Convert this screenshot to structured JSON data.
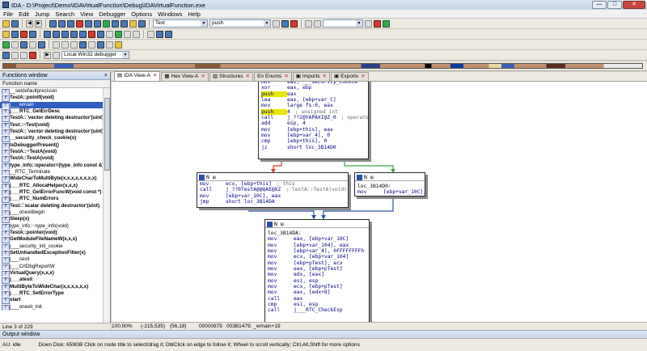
{
  "window": {
    "title": "IDA - D:\\Project\\Demo\\IDAVirtualFunction\\Debug\\IDAVirtualFunction.exe",
    "min": "—",
    "max": "□",
    "close": "✕"
  },
  "menu": [
    "File",
    "Edit",
    "Jump",
    "Search",
    "View",
    "Debugger",
    "Options",
    "Windows",
    "Help"
  ],
  "toolbar": {
    "search_type": "Text",
    "search_value": "push",
    "debugger": "Local Win32 debugger"
  },
  "functions_window": {
    "title": "Functions window",
    "column": "Function name",
    "close": "×",
    "items": [
      {
        "name": "__setdefaultprecision",
        "style": "normal"
      },
      {
        "name": "TestA::pointf(void)",
        "style": "bold"
      },
      {
        "name": "j___wmain",
        "style": "sel"
      },
      {
        "name": "j___RTC_GetErrDesc",
        "style": "bold"
      },
      {
        "name": "TestA::`vector deleting destructor'(uint)",
        "style": "bold"
      },
      {
        "name": "Test::~Test(void)",
        "style": "bold"
      },
      {
        "name": "TestA::`vector deleting destructor'(uint)",
        "style": "bold"
      },
      {
        "name": "__security_check_cookie(x)",
        "style": "bold"
      },
      {
        "name": "IsDebuggerPresent()",
        "style": "bold"
      },
      {
        "name": "TestA::~TestA(void)",
        "style": "bold"
      },
      {
        "name": "TestA::TestA(void)",
        "style": "bold"
      },
      {
        "name": "type_info::operator=(type_info const &)",
        "style": "bold"
      },
      {
        "name": "__RTC_Terminate",
        "style": "normal"
      },
      {
        "name": "WideCharToMultiByte(x,x,x,x,x,x,x,x)",
        "style": "bold"
      },
      {
        "name": "j___RTC_AllocaHelper(x,x,x)",
        "style": "bold"
      },
      {
        "name": "j___RTC_GetErrorFuncW(void const *)",
        "style": "bold"
      },
      {
        "name": "j___RTC_NumErrors",
        "style": "bold"
      },
      {
        "name": "Test::`scalar deleting destructor'(uint)",
        "style": "bold"
      },
      {
        "name": "j___onexitbegin",
        "style": "normal"
      },
      {
        "name": "Sleep(x)",
        "style": "bold"
      },
      {
        "name": "type_info::~type_info(void)",
        "style": "normal"
      },
      {
        "name": "TestA::pointer(void)",
        "style": "bold"
      },
      {
        "name": "GetModuleFileNameW(x,x,x)",
        "style": "bold"
      },
      {
        "name": "j___security_init_cookie",
        "style": "normal"
      },
      {
        "name": "SetUnhandledExceptionFilter(x)",
        "style": "bold"
      },
      {
        "name": "j___cexit",
        "style": "normal"
      },
      {
        "name": "j___CrtDbgReportW",
        "style": "normal"
      },
      {
        "name": "VirtualQuery(x,x,x)",
        "style": "bold"
      },
      {
        "name": "j___atexit",
        "style": "bold"
      },
      {
        "name": "MultiByteToWideChar(x,x,x,x,x,x)",
        "style": "bold"
      },
      {
        "name": "j___RTC_SetErrorType",
        "style": "bold"
      },
      {
        "name": "start",
        "style": "bold"
      },
      {
        "name": "j___onexit_Init",
        "style": "normal"
      }
    ],
    "status": "Line 3 of 229"
  },
  "tabs": [
    {
      "icon": "▤",
      "label": "IDA View-A",
      "close": "✕"
    },
    {
      "icon": "▦",
      "label": "Hex View-A",
      "close": "✕"
    },
    {
      "icon": "▥",
      "label": "Structures",
      "close": "✕"
    },
    {
      "icon": "En",
      "label": "Enums",
      "close": "✕"
    },
    {
      "icon": "▣",
      "label": "Imports",
      "close": "✕"
    },
    {
      "icon": "▣",
      "label": "Exports",
      "close": "✕"
    }
  ],
  "nodes": {
    "main": {
      "lines": [
        {
          "mn": "mov",
          "op": "eax, ___security_cookie"
        },
        {
          "mn": "xor",
          "op": "eax, ebp"
        },
        {
          "mn": "push",
          "op": "eax",
          "hl": true
        },
        {
          "mn": "lea",
          "op": "eax, [ebp+var_C]"
        },
        {
          "mn": "mov",
          "op": "large fs:0, eax"
        },
        {
          "mn": "push",
          "op": "4",
          "cm": "; unsigned int",
          "hl": true
        },
        {
          "mn": "call",
          "op": "j_??2@YAPAXI@Z_0",
          "cm": "; operator new(uint)"
        },
        {
          "mn": "add",
          "op": "esp, 4"
        },
        {
          "mn": "mov",
          "op": "[ebp+this], eax"
        },
        {
          "mn": "mov",
          "op": "[ebp+var_4], 0"
        },
        {
          "mn": "cmp",
          "op": "[ebp+this], 0"
        },
        {
          "mn": "jz",
          "op": "short loc_3B14D0"
        }
      ]
    },
    "left": {
      "header": "N ш",
      "lines": [
        {
          "mn": "mov",
          "op": "ecx, [ebp+this]",
          "cm": "; this"
        },
        {
          "mn": "call",
          "op": "j_??0TestA@@QAE@XZ",
          "cm": "; TestA::TestA(void)"
        },
        {
          "mn": "mov",
          "op": "[ebp+var_10C], eax"
        },
        {
          "mn": "jmp",
          "op": "short loc_3B14DA"
        }
      ]
    },
    "right": {
      "header": "N ш",
      "label": "loc_3B14D0:",
      "lines": [
        {
          "mn": "mov",
          "op": "[ebp+var_10C], 0"
        }
      ]
    },
    "bottom": {
      "header": "N ш",
      "label": "loc_3B14DA:",
      "lines": [
        {
          "mn": "mov",
          "op": "eax, [ebp+var_10C]"
        },
        {
          "mn": "mov",
          "op": "[ebp+var_104], eax"
        },
        {
          "mn": "mov",
          "op": "[ebp+var_4], 0FFFFFFFFh"
        },
        {
          "mn": "mov",
          "op": "ecx, [ebp+var_104]"
        },
        {
          "mn": "mov",
          "op": "[ebp+pTest], ecx"
        },
        {
          "mn": "mov",
          "op": "eax, [ebp+pTest]"
        },
        {
          "mn": "mov",
          "op": "edx, [eax]"
        },
        {
          "mn": "mov",
          "op": "esi, esp"
        },
        {
          "mn": "mov",
          "op": "ecx, [ebp+pTest]"
        },
        {
          "mn": "mov",
          "op": "eax, [edx+8]"
        },
        {
          "mn": "call",
          "op": "eax"
        },
        {
          "mn": "cmp",
          "op": "esi, esp"
        },
        {
          "mn": "call",
          "op": "j___RTC_CheckEsp"
        }
      ]
    }
  },
  "status": {
    "zoom": "100.00%",
    "coords": "(-215,535)",
    "pos": "(56,18)",
    "offset": "00000879",
    "addr": "003B1479: _wmain+19"
  },
  "output_window": {
    "title": "Output window"
  },
  "bottom": {
    "state": "AU:",
    "state_value": "idle",
    "mode": "Down",
    "message": "Disk: 659GB Click on node title to select/drag it; DblClick on edge to follow it; Wheel to scroll vertically; Ctrl,Alt,Shift for more options"
  },
  "colors": {
    "selection": "#2f5fbf",
    "highlight": "#e6e600",
    "edge_false": "#d23c2e",
    "edge_true": "#3aa84a",
    "edge_blue": "#2a4fa8"
  }
}
